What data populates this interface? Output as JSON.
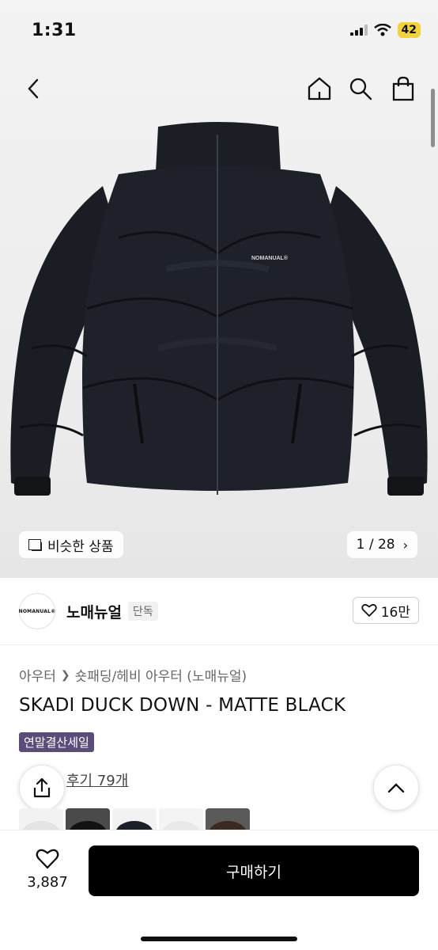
{
  "status": {
    "time": "1:31",
    "battery": "42"
  },
  "gallery": {
    "similar_label": "비슷한 상품",
    "counter": "1 / 28"
  },
  "brand": {
    "logo_text": "NOMANUAL®",
    "name": "노매뉴얼",
    "badge": "단독",
    "likes": "16만"
  },
  "breadcrumb": {
    "level1": "아우터",
    "level2": "숏패딩/헤비 아우터 (노매뉴얼)"
  },
  "product": {
    "title": "SKADI DUCK DOWN - MATTE BLACK",
    "sale_badge": "연말결산세일",
    "jacket_logo": "NOMANUAL®"
  },
  "review": {
    "label": "후기 79개"
  },
  "bottom": {
    "wish_count": "3,887",
    "buy_label": "구매하기"
  },
  "colors": {
    "sale_badge": "#5b4c7a",
    "buy_button": "#000000",
    "battery": "#f2d33a"
  },
  "icons": [
    "back-icon",
    "home-icon",
    "search-icon",
    "bag-icon",
    "share-icon",
    "chevron-up-icon",
    "heart-icon"
  ]
}
